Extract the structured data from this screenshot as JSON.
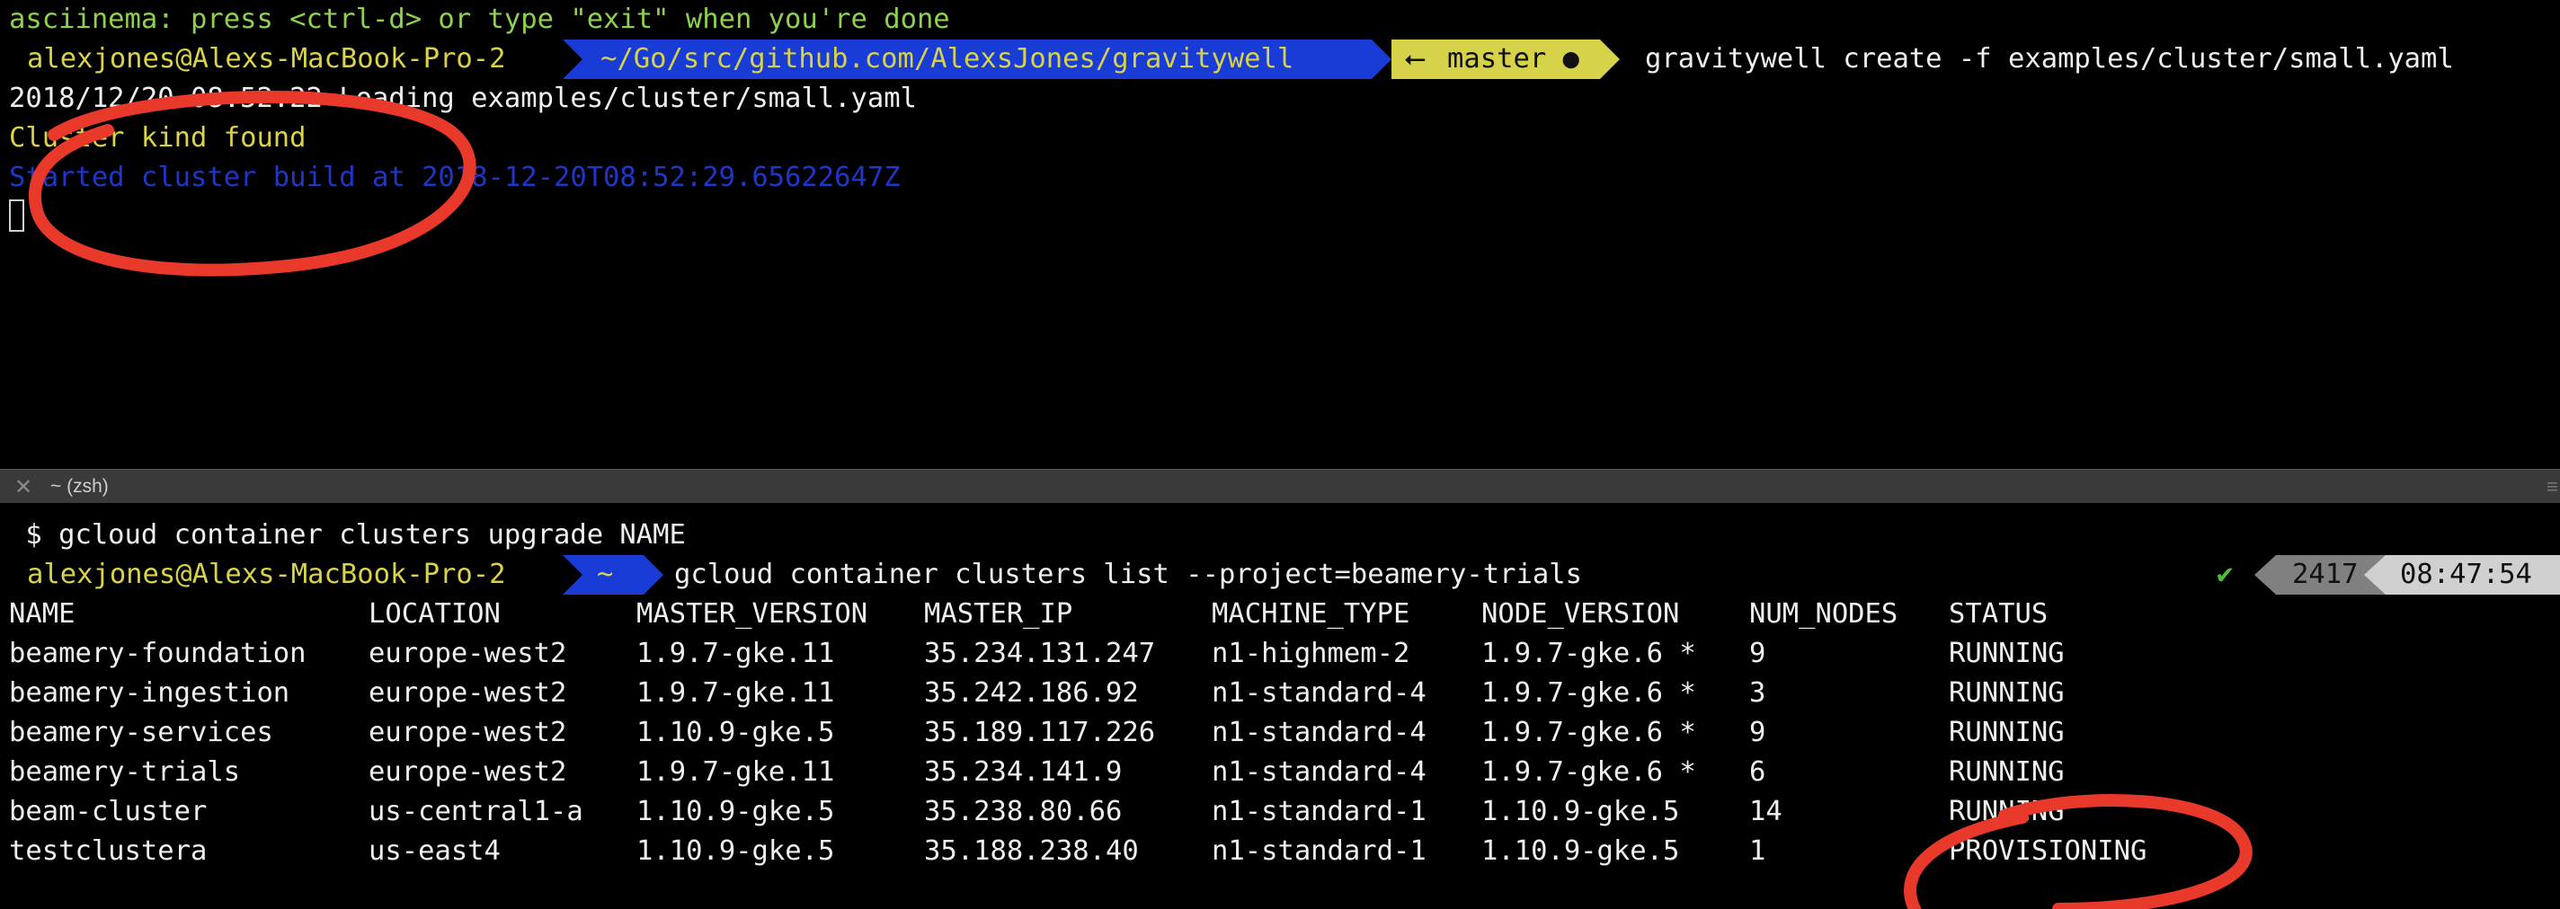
{
  "top_pane": {
    "asciinema_notice": "asciinema: press <ctrl-d> or type \"exit\" when you're done",
    "prompt": {
      "user_host": "alexjones@Alexs-MacBook-Pro-2",
      "path": "~/Go/src/github.com/AlexsJones/gravitywell",
      "branch_icon": "⭠",
      "branch": "master ●",
      "command": "gravitywell create -f examples/cluster/small.yaml"
    },
    "output_lines": [
      "2018/12/20 08:52:22 Loading examples/cluster/small.yaml",
      "Cluster kind found",
      "Started cluster build at 2018-12-20T08:52:29.65622647Z"
    ]
  },
  "divider": {
    "close_icon": "close-icon",
    "tab_title": "~ (zsh)"
  },
  "bottom_pane": {
    "previous_command": " $ gcloud container clusters upgrade NAME",
    "prompt": {
      "user_host": "alexjones@Alexs-MacBook-Pro-2",
      "path": "~",
      "command": "gcloud container clusters list --project=beamery-trials"
    },
    "right_prompt": {
      "check": "✔",
      "history_number": "2417",
      "time": "08:47:54"
    },
    "table": {
      "headers": [
        "NAME",
        "LOCATION",
        "MASTER_VERSION",
        "MASTER_IP",
        "MACHINE_TYPE",
        "NODE_VERSION",
        "NUM_NODES",
        "STATUS"
      ],
      "rows": [
        [
          "beamery-foundation",
          "europe-west2",
          "1.9.7-gke.11",
          "35.234.131.247",
          "n1-highmem-2",
          "1.9.7-gke.6 *",
          "9",
          "RUNNING"
        ],
        [
          "beamery-ingestion",
          "europe-west2",
          "1.9.7-gke.11",
          "35.242.186.92",
          "n1-standard-4",
          "1.9.7-gke.6 *",
          "3",
          "RUNNING"
        ],
        [
          "beamery-services",
          "europe-west2",
          "1.10.9-gke.5",
          "35.189.117.226",
          "n1-standard-4",
          "1.9.7-gke.6 *",
          "9",
          "RUNNING"
        ],
        [
          "beamery-trials",
          "europe-west2",
          "1.9.7-gke.11",
          "35.234.141.9",
          "n1-standard-4",
          "1.9.7-gke.6 *",
          "6",
          "RUNNING"
        ],
        [
          "beam-cluster",
          "us-central1-a",
          "1.10.9-gke.5",
          "35.238.80.66",
          "n1-standard-1",
          "1.10.9-gke.5",
          "14",
          "RUNNING"
        ],
        [
          "testclustera",
          "us-east4",
          "1.10.9-gke.5",
          "35.188.238.40",
          "n1-standard-1",
          "1.10.9-gke.5",
          "1",
          "PROVISIONING"
        ]
      ]
    }
  },
  "colors": {
    "background": "#000000",
    "prompt_blue": "#1a3cd6",
    "prompt_yellow": "#d6d24a",
    "annotation_red": "#e8392a",
    "right_prompt_grey": "#808080"
  }
}
